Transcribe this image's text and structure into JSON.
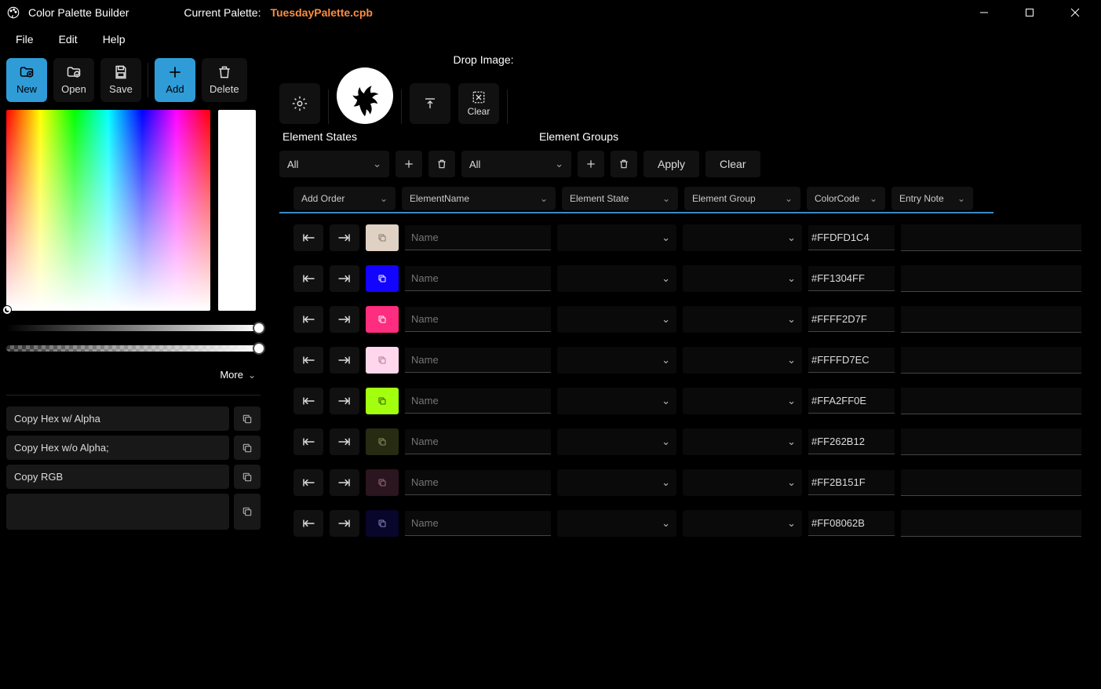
{
  "app": {
    "title": "Color Palette Builder",
    "current_label": "Current Palette:",
    "current_file": "TuesdayPalette.cpb"
  },
  "menu": {
    "file": "File",
    "edit": "Edit",
    "help": "Help"
  },
  "toolbar": {
    "new": "New",
    "open": "Open",
    "save": "Save",
    "add": "Add",
    "delete": "Delete"
  },
  "picker": {
    "more": "More",
    "copy_hex_alpha": "Copy Hex w/ Alpha",
    "copy_hex_noalpha": "Copy Hex w/o Alpha;",
    "copy_rgb": "Copy RGB"
  },
  "content": {
    "drop_label": "Drop Image:",
    "clear": "Clear",
    "element_states": "Element States",
    "element_groups": "Element Groups",
    "all": "All",
    "apply": "Apply",
    "clear2": "Clear",
    "headers": {
      "add_order": "Add Order",
      "element_name": "ElementName",
      "element_state": "Element State",
      "element_group": "Element Group",
      "color_code": "ColorCode",
      "entry_note": "Entry Note"
    },
    "name_placeholder": "Name"
  },
  "rows": [
    {
      "color": "#DFD1C4",
      "swatch": "#DFD1C4",
      "code": "#FFDFD1C4",
      "icon_color": "#8a7a6c"
    },
    {
      "color": "#1304FF",
      "swatch": "#1304FF",
      "code": "#FF1304FF",
      "icon_color": "#ffffff"
    },
    {
      "color": "#FF2D7F",
      "swatch": "#FF2D7F",
      "code": "#FFFF2D7F",
      "icon_color": "#ffffff"
    },
    {
      "color": "#FFD7EC",
      "swatch": "#FFD7EC",
      "code": "#FFFFD7EC",
      "icon_color": "#b07a98"
    },
    {
      "color": "#A2FF0E",
      "swatch": "#A2FF0E",
      "code": "#FFA2FF0E",
      "icon_color": "#3a5a00"
    },
    {
      "color": "#262B12",
      "swatch": "#262B12",
      "code": "#FF262B12",
      "icon_color": "#8a9060"
    },
    {
      "color": "#2B151F",
      "swatch": "#2B151F",
      "code": "#FF2B151F",
      "icon_color": "#9a6a7a"
    },
    {
      "color": "#08062B",
      "swatch": "#08062B",
      "code": "#FF08062B",
      "icon_color": "#8a88c0"
    }
  ]
}
